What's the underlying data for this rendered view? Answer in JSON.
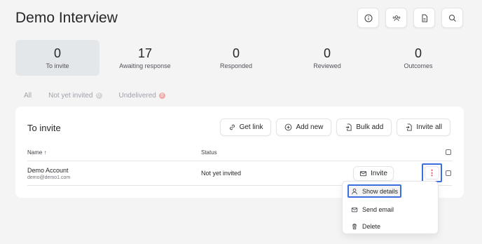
{
  "page": {
    "title": "Demo Interview"
  },
  "top_actions": [
    {
      "name": "info-icon"
    },
    {
      "name": "users-icon"
    },
    {
      "name": "document-icon"
    },
    {
      "name": "search-icon"
    }
  ],
  "stats": [
    {
      "value": "0",
      "label": "To invite",
      "active": true
    },
    {
      "value": "17",
      "label": "Awaiting response"
    },
    {
      "value": "0",
      "label": "Responded"
    },
    {
      "value": "0",
      "label": "Reviewed"
    },
    {
      "value": "0",
      "label": "Outcomes"
    }
  ],
  "filters": [
    {
      "label": "All",
      "count": ""
    },
    {
      "label": "Not yet invited",
      "count": "0"
    },
    {
      "label": "Undelivered",
      "count": "0"
    }
  ],
  "card": {
    "title": "To invite",
    "actions": {
      "get_link": "Get link",
      "add_new": "Add new",
      "bulk_add": "Bulk add",
      "invite_all": "Invite all"
    },
    "columns": {
      "name": "Name ↑",
      "status": "Status"
    },
    "rows": [
      {
        "name": "Demo Account",
        "email": "demo@demo1.com",
        "status": "Not yet invited",
        "invite_label": "Invite",
        "menu_glyph": "⋮"
      }
    ]
  },
  "row_menu": {
    "items": [
      {
        "label": "Show details",
        "icon": "user-icon",
        "highlighted": true
      },
      {
        "label": "Send email",
        "icon": "mail-icon"
      },
      {
        "label": "Delete",
        "icon": "trash-icon"
      }
    ]
  },
  "colors": {
    "accent": "#3b6fe0",
    "danger": "#e0424b",
    "badge_red": "#f4a7a7"
  }
}
